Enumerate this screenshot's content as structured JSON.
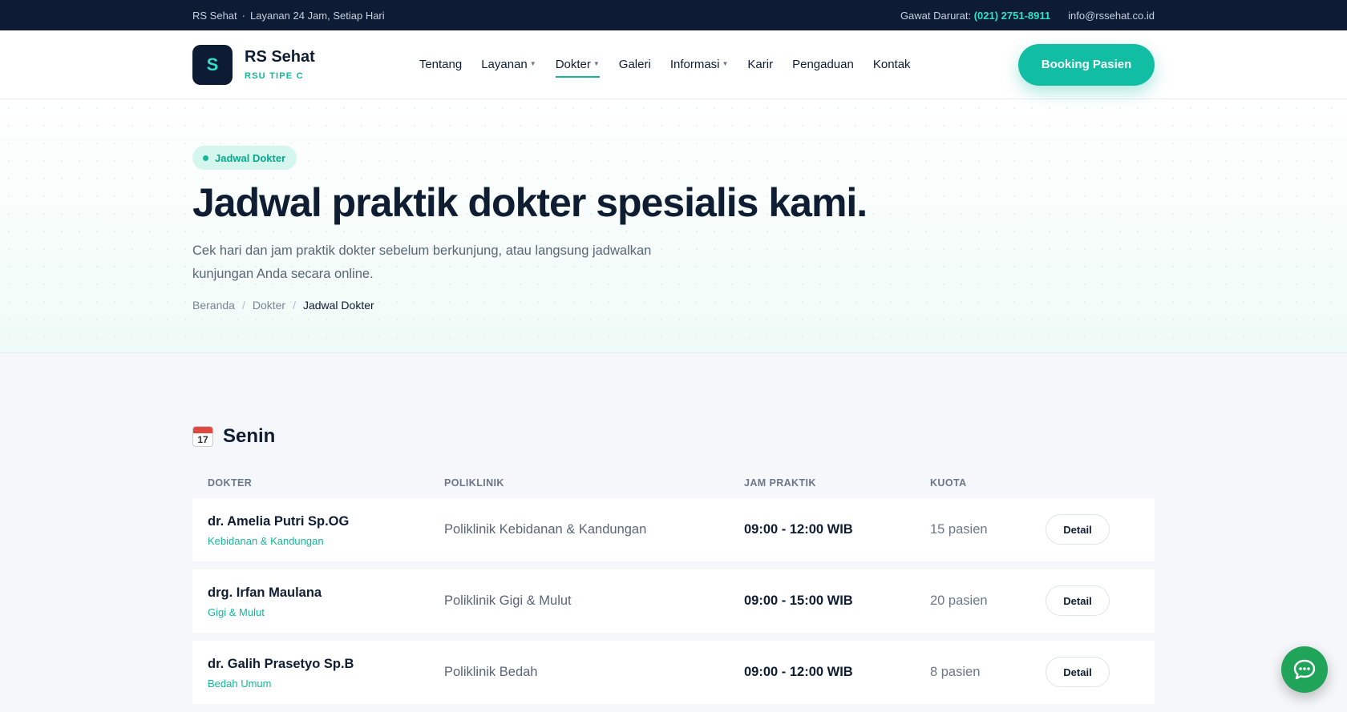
{
  "topbar": {
    "brand": "RS Sehat",
    "tagline": "Layanan 24 Jam, Setiap Hari",
    "emergency_label": "Gawat Darurat:",
    "emergency_phone": "(021) 2751-8911",
    "email": "info@rssehat.co.id"
  },
  "header": {
    "logo_letter": "S",
    "name": "RS Sehat",
    "type": "RSU TIPE C",
    "nav": [
      {
        "label": "Tentang"
      },
      {
        "label": "Layanan"
      },
      {
        "label": "Dokter"
      },
      {
        "label": "Galeri"
      },
      {
        "label": "Informasi"
      },
      {
        "label": "Karir"
      },
      {
        "label": "Pengaduan"
      },
      {
        "label": "Kontak"
      }
    ],
    "booking_label": "Booking Pasien"
  },
  "hero": {
    "badge": "Jadwal Dokter",
    "title": "Jadwal praktik dokter spesialis kami.",
    "lead": "Cek hari dan jam praktik dokter sebelum berkunjung, atau langsung jadwalkan kunjungan Anda secara online.",
    "breadcrumb": [
      "Beranda",
      "Dokter",
      "Jadwal Dokter"
    ]
  },
  "schedule": {
    "day_icon_number": "17",
    "day": "Senin",
    "columns": [
      "DOKTER",
      "POLIKLINIK",
      "JAM PRAKTIK",
      "KUOTA"
    ],
    "rows": [
      {
        "name": "dr. Amelia Putri Sp.OG",
        "specialty": "Kebidanan & Kandungan",
        "clinic": "Poliklinik Kebidanan & Kandungan",
        "hours": "09:00 - 12:00 WIB",
        "quota": "15 pasien",
        "action": "Detail"
      },
      {
        "name": "drg. Irfan Maulana",
        "specialty": "Gigi & Mulut",
        "clinic": "Poliklinik Gigi & Mulut",
        "hours": "09:00 - 15:00 WIB",
        "quota": "20 pasien",
        "action": "Detail"
      },
      {
        "name": "dr. Galih Prasetyo Sp.B",
        "specialty": "Bedah Umum",
        "clinic": "Poliklinik Bedah",
        "hours": "09:00 - 12:00 WIB",
        "quota": "8 pasien",
        "action": "Detail"
      }
    ]
  }
}
